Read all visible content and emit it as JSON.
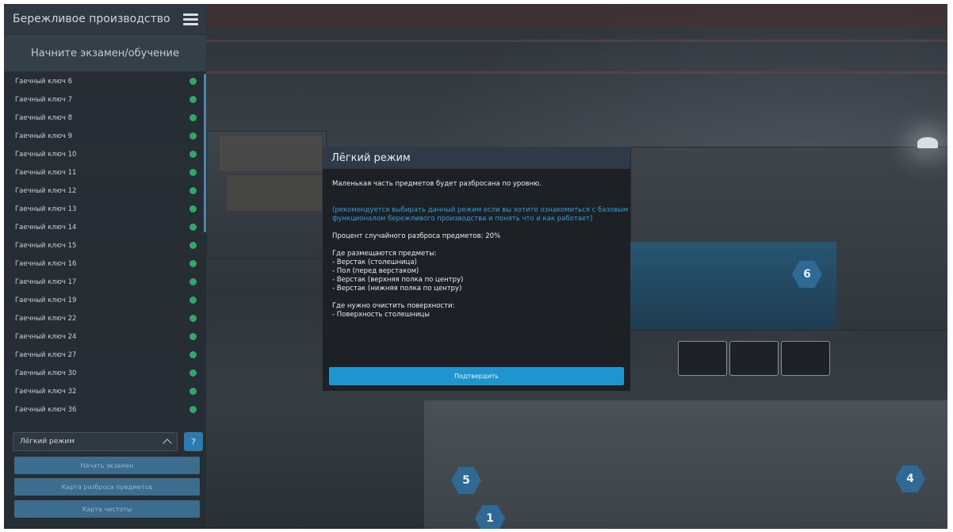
{
  "sidebar": {
    "title": "Бережливое производство",
    "subtitle": "Начните экзамен/обучение",
    "items": [
      {
        "label": "Гаечный ключ 6"
      },
      {
        "label": "Гаечный ключ 7"
      },
      {
        "label": "Гаечный ключ 8"
      },
      {
        "label": "Гаечный ключ 9"
      },
      {
        "label": "Гаечный ключ 10"
      },
      {
        "label": "Гаечный ключ 11"
      },
      {
        "label": "Гаечный ключ 12"
      },
      {
        "label": "Гаечный ключ 13"
      },
      {
        "label": "Гаечный ключ 14"
      },
      {
        "label": "Гаечный ключ 15"
      },
      {
        "label": "Гаечный ключ 16"
      },
      {
        "label": "Гаечный ключ 17"
      },
      {
        "label": "Гаечный ключ 19"
      },
      {
        "label": "Гаечный ключ 22"
      },
      {
        "label": "Гаечный ключ 24"
      },
      {
        "label": "Гаечный ключ 27"
      },
      {
        "label": "Гаечный ключ 30"
      },
      {
        "label": "Гаечный ключ 32"
      },
      {
        "label": "Гаечный ключ 36"
      }
    ],
    "status_color": "#2fa96a",
    "mode_value": "Лёгкий режим",
    "help_label": "?",
    "start_exam_label": "Начать экзамен",
    "scatter_map_label": "Карта разброса предметов",
    "clean_map_label": "Карта чистоты"
  },
  "modal": {
    "title": "Лёгкий режим",
    "line1": "Маленькая часть предметов будет разбросана по уровню.",
    "recommend_line1": "(рекомендуется выбирать данный режим если вы хотите ознакомиться с базовым",
    "recommend_line2": "функционалом бережливого производства и понять что и как работает)",
    "percent": "Процент случайного разброса предметов: 20%",
    "places_title": "Где размещаются предметы:",
    "places": [
      "- Верстак (столешница)",
      "- Пол (перед верстаком)",
      "- Верстак (верхняя полка по центру)",
      "- Верстак (нижняя полка по центру)"
    ],
    "clean_title": "Где нужно очистить поверхности:",
    "clean_items": [
      "- Поверхность столешницы"
    ],
    "confirm_label": "Подтвердить",
    "accent_color": "#1f95cf"
  },
  "scene": {
    "markers": [
      "6",
      "5",
      "4",
      "1"
    ]
  }
}
